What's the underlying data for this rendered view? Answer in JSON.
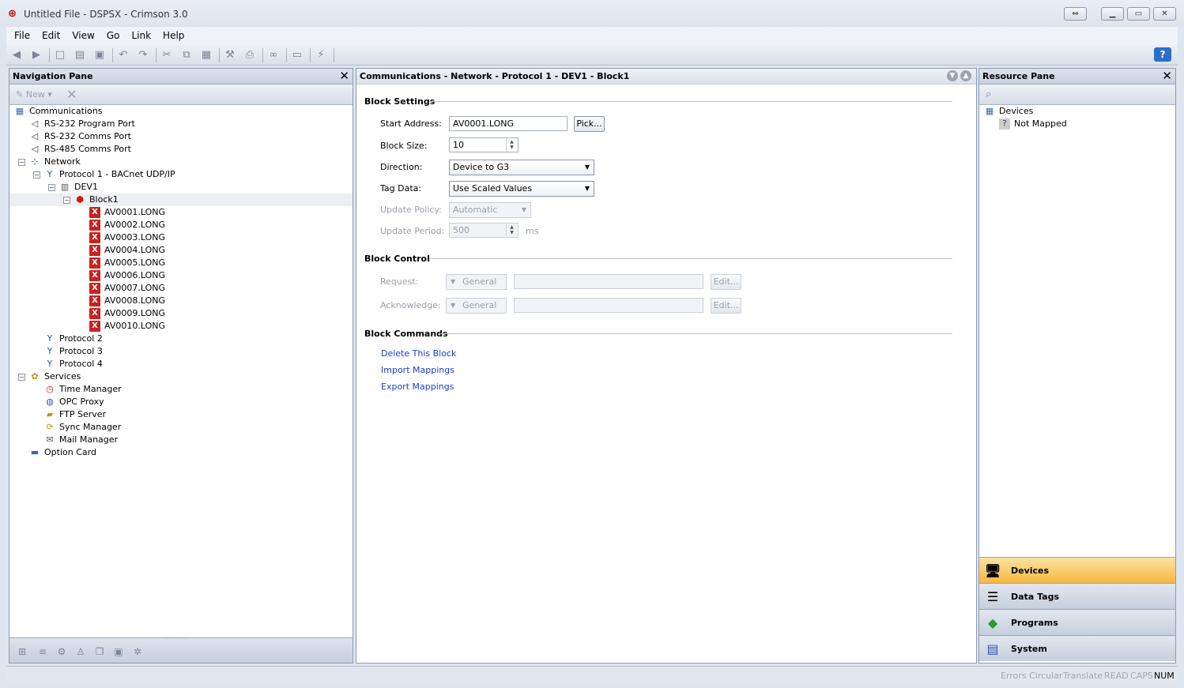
{
  "window": {
    "title": "Untitled File - DSPSX - Crimson 3.0"
  },
  "menu": [
    "File",
    "Edit",
    "View",
    "Go",
    "Link",
    "Help"
  ],
  "nav_pane": {
    "title": "Navigation Pane",
    "new_label": "New",
    "tree": [
      {
        "label": "Communications",
        "level": 0,
        "icon": "communications-icon"
      },
      {
        "label": "RS-232 Program Port",
        "level": 1,
        "icon": "port-icon"
      },
      {
        "label": "RS-232 Comms Port",
        "level": 1,
        "icon": "port-icon"
      },
      {
        "label": "RS-485 Comms Port",
        "level": 1,
        "icon": "port-icon"
      },
      {
        "label": "Network",
        "level": 1,
        "icon": "network-icon",
        "expanded": true
      },
      {
        "label": "Protocol 1 - BACnet UDP/IP",
        "level": 2,
        "icon": "protocol-icon",
        "expanded": true
      },
      {
        "label": "DEV1",
        "level": 3,
        "icon": "device-icon",
        "expanded": true
      },
      {
        "label": "Block1",
        "level": 4,
        "icon": "block-icon",
        "expanded": true,
        "selected": true
      },
      {
        "label": "AV0001.LONG",
        "level": 5,
        "icon": "unmapped-x-icon"
      },
      {
        "label": "AV0002.LONG",
        "level": 5,
        "icon": "unmapped-x-icon"
      },
      {
        "label": "AV0003.LONG",
        "level": 5,
        "icon": "unmapped-x-icon"
      },
      {
        "label": "AV0004.LONG",
        "level": 5,
        "icon": "unmapped-x-icon"
      },
      {
        "label": "AV0005.LONG",
        "level": 5,
        "icon": "unmapped-x-icon"
      },
      {
        "label": "AV0006.LONG",
        "level": 5,
        "icon": "unmapped-x-icon"
      },
      {
        "label": "AV0007.LONG",
        "level": 5,
        "icon": "unmapped-x-icon"
      },
      {
        "label": "AV0008.LONG",
        "level": 5,
        "icon": "unmapped-x-icon"
      },
      {
        "label": "AV0009.LONG",
        "level": 5,
        "icon": "unmapped-x-icon"
      },
      {
        "label": "AV0010.LONG",
        "level": 5,
        "icon": "unmapped-x-icon"
      },
      {
        "label": "Protocol 2",
        "level": 2,
        "icon": "protocol-icon"
      },
      {
        "label": "Protocol 3",
        "level": 2,
        "icon": "protocol-icon"
      },
      {
        "label": "Protocol 4",
        "level": 2,
        "icon": "protocol-icon"
      },
      {
        "label": "Services",
        "level": 1,
        "icon": "services-icon",
        "expanded": true
      },
      {
        "label": "Time Manager",
        "level": 2,
        "icon": "clock-icon"
      },
      {
        "label": "OPC Proxy",
        "level": 2,
        "icon": "opc-icon"
      },
      {
        "label": "FTP Server",
        "level": 2,
        "icon": "folder-icon"
      },
      {
        "label": "Sync Manager",
        "level": 2,
        "icon": "sync-icon"
      },
      {
        "label": "Mail Manager",
        "level": 2,
        "icon": "mail-icon"
      },
      {
        "label": "Option Card",
        "level": 1,
        "icon": "card-icon"
      }
    ]
  },
  "main": {
    "breadcrumb": "Communications - Network - Protocol 1 - DEV1 - Block1",
    "block_settings": {
      "title": "Block Settings",
      "start_address_label": "Start Address:",
      "start_address_value": "AV0001.LONG",
      "pick_label": "Pick...",
      "block_size_label": "Block Size:",
      "block_size_value": "10",
      "direction_label": "Direction:",
      "direction_value": "Device to G3",
      "tag_data_label": "Tag Data:",
      "tag_data_value": "Use Scaled Values",
      "update_policy_label": "Update Policy:",
      "update_policy_value": "Automatic",
      "update_period_label": "Update Period:",
      "update_period_value": "500",
      "update_period_units": "ms"
    },
    "block_control": {
      "title": "Block Control",
      "request_label": "Request:",
      "request_mode": "General",
      "acknowledge_label": "Acknowledge:",
      "acknowledge_mode": "General",
      "edit_label": "Edit..."
    },
    "block_commands": {
      "title": "Block Commands",
      "links": [
        "Delete This Block",
        "Import Mappings",
        "Export Mappings"
      ]
    }
  },
  "resource_pane": {
    "title": "Resource Pane",
    "tree": [
      {
        "label": "Devices",
        "level": 0
      },
      {
        "label": "Not Mapped",
        "level": 1
      }
    ],
    "categories": [
      {
        "label": "Devices",
        "active": true
      },
      {
        "label": "Data Tags",
        "active": false
      },
      {
        "label": "Programs",
        "active": false
      },
      {
        "label": "System",
        "active": false
      }
    ]
  },
  "status": {
    "items": [
      {
        "label": "Errors",
        "on": false
      },
      {
        "label": "Circular",
        "on": false
      },
      {
        "label": "Translate",
        "on": false
      },
      {
        "label": "READ",
        "on": false
      },
      {
        "label": "CAPS",
        "on": false
      },
      {
        "label": "NUM",
        "on": true
      }
    ]
  },
  "colors": {
    "accent": "#f6b840",
    "link": "#1a3fc8",
    "unmapped": "#cc2020"
  }
}
